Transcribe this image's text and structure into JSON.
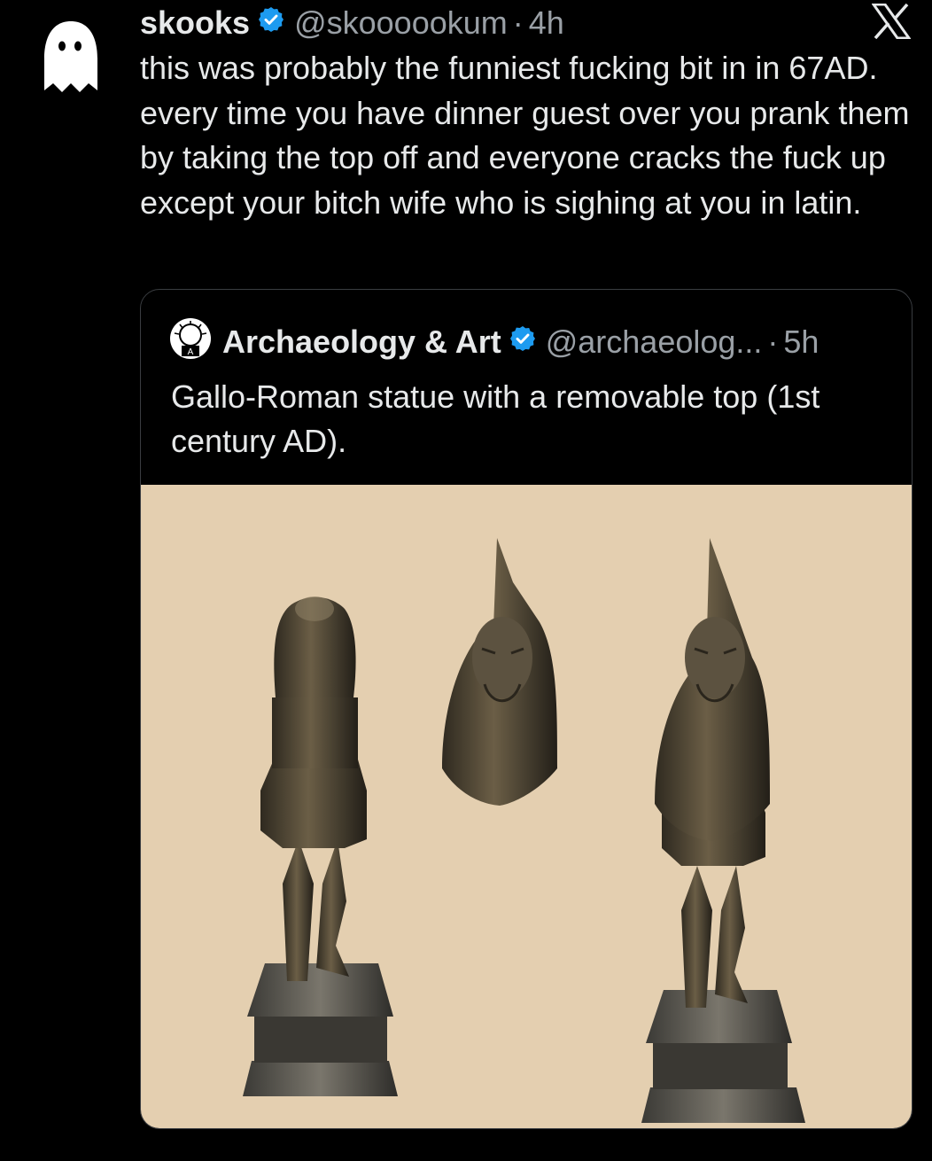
{
  "tweet": {
    "author_name": "skooks",
    "author_handle": "@skoooookum",
    "separator": "·",
    "time": "4h",
    "text": "this was probably the funniest fucking bit in in 67AD. every time you have dinner guest over you prank them by taking the top off and everyone cracks the fuck up except your bitch wife who is sighing at you in latin.",
    "avatar_icon": "ghost-icon",
    "verified_icon": "verified-badge-icon",
    "platform_icon": "x-logo-icon"
  },
  "quoted_tweet": {
    "author_name": "Archaeology & Art",
    "author_handle": "@archaeolog...",
    "separator": "·",
    "time": "5h",
    "text": "Gallo-Roman statue with a removable top (1st century AD).",
    "avatar_icon": "archaeology-logo-icon",
    "verified_icon": "verified-badge-icon",
    "media_icon": "bronze-statue-photo"
  },
  "colors": {
    "background": "#000000",
    "text": "#e7e9ea",
    "secondary_text": "#9aa0a6",
    "verified": "#1d9bf0",
    "media_background": "#e4cfb0"
  }
}
